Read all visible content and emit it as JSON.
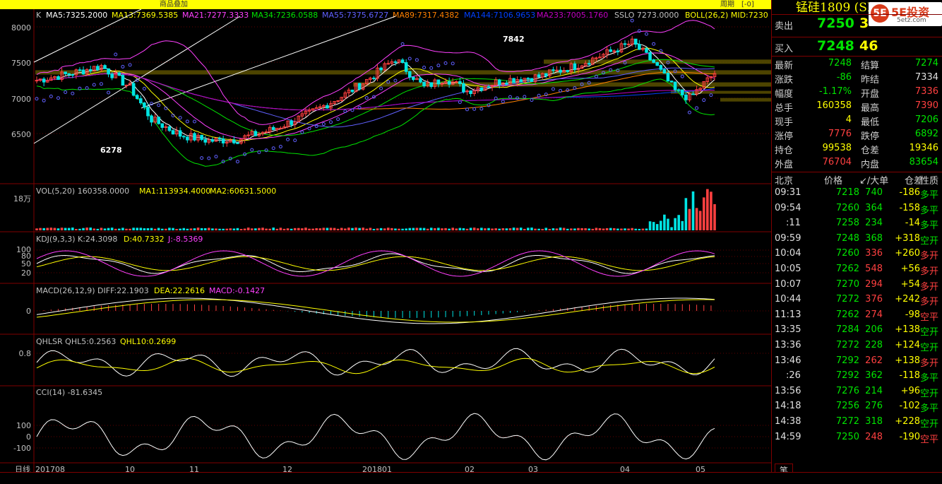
{
  "toolbar": {
    "center_label": "商品叠加",
    "right_label1": "周期",
    "right_label2": "[-0]"
  },
  "main_indicators": {
    "k": "K",
    "ma5": "MA5:7325.2000",
    "ma13": "MA13:7369.5385",
    "ma21": "MA21:7277.3333",
    "ma34": "MA34:7236.0588",
    "ma55": "MA55:7375.6727",
    "ma89": "MA89:7317.4382",
    "ma144": "MA144:7106.9653",
    "ma233": "MA233:7005.1760",
    "sslo": "SSLO  7273.0000",
    "boll": "BOLL(26,2)  MID:7230"
  },
  "price_axis": [
    "8000",
    "7500",
    "7000",
    "6500"
  ],
  "annotations": {
    "high": "7842",
    "low": "6278"
  },
  "vol": {
    "title": "VOL(5,20) 160358.0000",
    "ma1": "MA1:113934.4000",
    "ma2": "MA2:60631.5000",
    "axis": "18万"
  },
  "kdj": {
    "title": "KDJ(9,3,3) K:24.3098",
    "d": "D:40.7332",
    "j": "J:-8.5369",
    "axis": [
      "100",
      "80",
      "50",
      "20"
    ]
  },
  "macd": {
    "title": "MACD(26,12,9) DIFF:22.1903",
    "dea": "DEA:22.2616",
    "macd": "MACD:-0.1427",
    "axis": "0"
  },
  "qhlsr": {
    "title": "QHLSR  QHL5:0.2563",
    "qhl10": "QHL10:0.2699",
    "axis": "0.8"
  },
  "cci": {
    "title": "CCI(14) -81.6345",
    "axis": [
      "100",
      "0",
      "-100"
    ]
  },
  "x_axis": {
    "period_tab": "日线",
    "labels": [
      "201708",
      "10",
      "11",
      "12",
      "201801",
      "02",
      "03",
      "04",
      "05"
    ]
  },
  "right_panel": {
    "title": "锰硅1809 (SM809)",
    "logo": {
      "mark": "5E",
      "brand": "5E投资",
      "url": "5etz.com"
    },
    "sell_label": "卖出",
    "sell_price": "7250",
    "sell_qty": "3",
    "buy_label": "买入",
    "buy_price": "7248",
    "buy_qty": "46",
    "stats": [
      {
        "l1": "最新",
        "v1": "7248",
        "c1": "green",
        "l2": "结算",
        "v2": "7274",
        "c2": "green"
      },
      {
        "l1": "涨跌",
        "v1": "-86",
        "c1": "green",
        "l2": "昨结",
        "v2": "7334",
        "c2": "white"
      },
      {
        "l1": "幅度",
        "v1": "-1.17%",
        "c1": "green",
        "l2": "开盘",
        "v2": "7336",
        "c2": "red"
      },
      {
        "l1": "总手",
        "v1": "160358",
        "c1": "yellow",
        "l2": "最高",
        "v2": "7390",
        "c2": "red"
      },
      {
        "l1": "现手",
        "v1": "4",
        "c1": "yellow",
        "l2": "最低",
        "v2": "7206",
        "c2": "green"
      },
      {
        "l1": "涨停",
        "v1": "7776",
        "c1": "red",
        "l2": "跌停",
        "v2": "6892",
        "c2": "green"
      },
      {
        "l1": "持仓",
        "v1": "99538",
        "c1": "yellow",
        "l2": "仓差",
        "v2": "19346",
        "c2": "yellow"
      },
      {
        "l1": "外盘",
        "v1": "76704",
        "c1": "red",
        "l2": "内盘",
        "v2": "83654",
        "c2": "green"
      }
    ],
    "ticks_header": {
      "time": "北京",
      "price": "价格",
      "vol": "↙/大单",
      "oi": "仓差",
      "type": "性质"
    },
    "ticks": [
      {
        "time": "09:31",
        "price": "7218",
        "pc": "green",
        "vol": "740",
        "vc": "green",
        "oi": "-186",
        "oc": "yellow",
        "type": "多平",
        "tc": "green"
      },
      {
        "time": "09:54",
        "price": "7260",
        "pc": "green",
        "vol": "364",
        "vc": "green",
        "oi": "-158",
        "oc": "yellow",
        "type": "多平",
        "tc": "green"
      },
      {
        "time": ":11",
        "price": "7258",
        "pc": "green",
        "vol": "234",
        "vc": "green",
        "oi": "-14",
        "oc": "yellow",
        "type": "多平",
        "tc": "green"
      },
      {
        "time": "09:59",
        "price": "7248",
        "pc": "green",
        "vol": "368",
        "vc": "green",
        "oi": "+318",
        "oc": "yellow",
        "type": "空开",
        "tc": "green"
      },
      {
        "time": "10:04",
        "price": "7260",
        "pc": "green",
        "vol": "336",
        "vc": "red",
        "oi": "+260",
        "oc": "yellow",
        "type": "多开",
        "tc": "red"
      },
      {
        "time": "10:05",
        "price": "7262",
        "pc": "green",
        "vol": "548",
        "vc": "red",
        "oi": "+56",
        "oc": "yellow",
        "type": "多开",
        "tc": "red"
      },
      {
        "time": "10:07",
        "price": "7270",
        "pc": "green",
        "vol": "294",
        "vc": "red",
        "oi": "+54",
        "oc": "yellow",
        "type": "多开",
        "tc": "red"
      },
      {
        "time": "10:44",
        "price": "7272",
        "pc": "green",
        "vol": "376",
        "vc": "red",
        "oi": "+242",
        "oc": "yellow",
        "type": "多开",
        "tc": "red"
      },
      {
        "time": "11:13",
        "price": "7262",
        "pc": "green",
        "vol": "274",
        "vc": "red",
        "oi": "-98",
        "oc": "yellow",
        "type": "空平",
        "tc": "red"
      },
      {
        "time": "13:35",
        "price": "7284",
        "pc": "green",
        "vol": "206",
        "vc": "green",
        "oi": "+138",
        "oc": "yellow",
        "type": "空开",
        "tc": "green"
      },
      {
        "time": "13:36",
        "price": "7272",
        "pc": "green",
        "vol": "228",
        "vc": "green",
        "oi": "+124",
        "oc": "yellow",
        "type": "空开",
        "tc": "green"
      },
      {
        "time": "13:46",
        "price": "7292",
        "pc": "green",
        "vol": "262",
        "vc": "red",
        "oi": "+138",
        "oc": "yellow",
        "type": "多开",
        "tc": "red"
      },
      {
        "time": ":26",
        "price": "7292",
        "pc": "green",
        "vol": "362",
        "vc": "green",
        "oi": "-118",
        "oc": "yellow",
        "type": "多平",
        "tc": "green"
      },
      {
        "time": "13:56",
        "price": "7276",
        "pc": "green",
        "vol": "214",
        "vc": "green",
        "oi": "+96",
        "oc": "yellow",
        "type": "空开",
        "tc": "green"
      },
      {
        "time": "14:18",
        "price": "7256",
        "pc": "green",
        "vol": "276",
        "vc": "green",
        "oi": "-102",
        "oc": "yellow",
        "type": "多平",
        "tc": "green"
      },
      {
        "time": "14:38",
        "price": "7272",
        "pc": "green",
        "vol": "318",
        "vc": "green",
        "oi": "+228",
        "oc": "yellow",
        "type": "空开",
        "tc": "green"
      },
      {
        "time": "14:59",
        "price": "7250",
        "pc": "green",
        "vol": "248",
        "vc": "red",
        "oi": "-190",
        "oc": "yellow",
        "type": "空平",
        "tc": "red"
      }
    ],
    "tab_label": "笔"
  },
  "colors": {
    "up": "#ff4040",
    "down": "#00e4e4",
    "ma5": "#ffffff",
    "ma13": "#ffff00",
    "ma21": "#ff40ff",
    "ma34": "#00e400",
    "ma55": "#6060ff",
    "ma89": "#ff8000",
    "ma144": "#0040ff",
    "ma233": "#c000c0",
    "sar": "#6060ff"
  }
}
